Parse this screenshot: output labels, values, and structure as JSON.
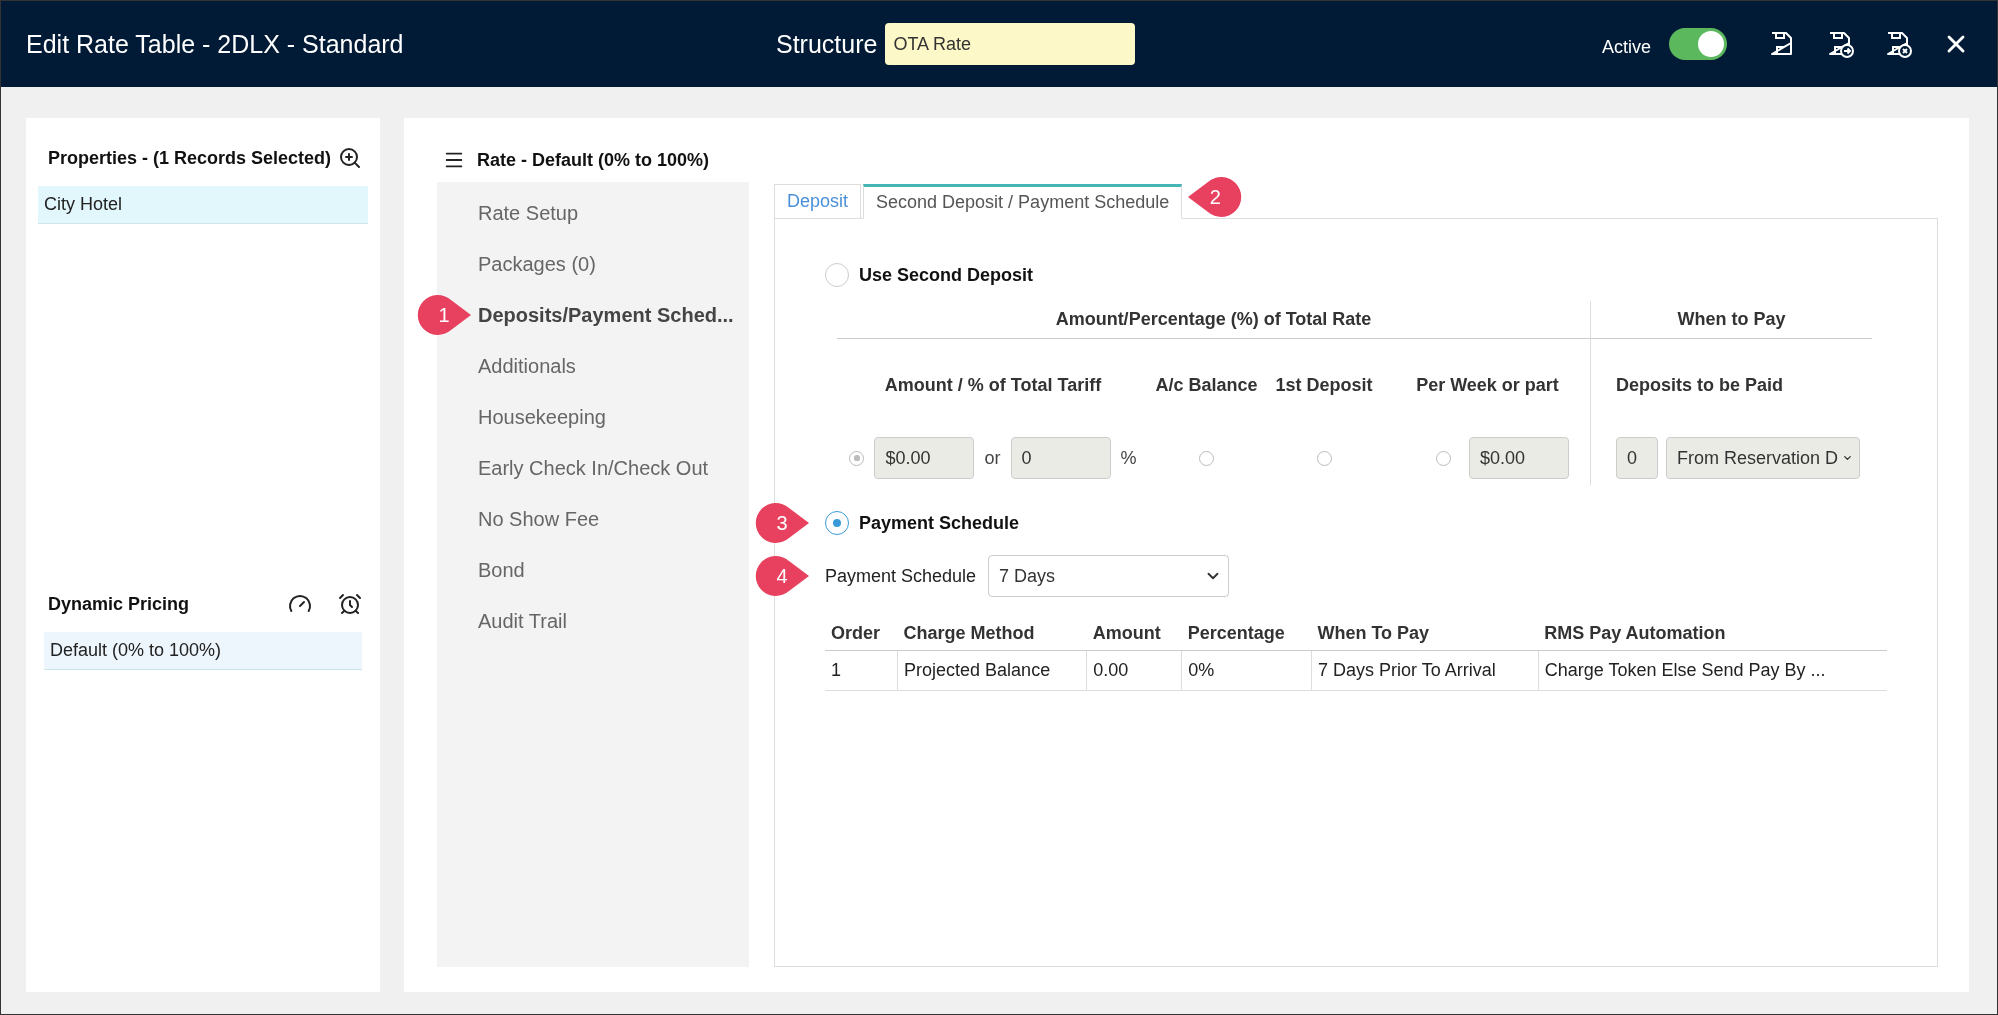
{
  "header": {
    "title": "Edit Rate Table - 2DLX - Standard",
    "structure_label": "Structure",
    "structure_value": "OTA Rate",
    "active_label": "Active",
    "active_on": true
  },
  "properties": {
    "title": "Properties - (1 Records Selected)",
    "items": [
      {
        "label": "City Hotel",
        "selected": true
      }
    ]
  },
  "dynamic_pricing": {
    "title": "Dynamic Pricing",
    "items": [
      {
        "label": "Default (0% to 100%)",
        "selected": true
      }
    ]
  },
  "rate": {
    "title": "Rate - Default (0% to 100%)"
  },
  "nav": [
    {
      "label": "Rate Setup",
      "selected": false
    },
    {
      "label": "Packages (0)",
      "selected": false
    },
    {
      "label": "Deposits/Payment Sched...",
      "selected": true
    },
    {
      "label": "Additionals",
      "selected": false
    },
    {
      "label": "Housekeeping",
      "selected": false
    },
    {
      "label": "Early Check In/Check Out",
      "selected": false
    },
    {
      "label": "No Show Fee",
      "selected": false
    },
    {
      "label": "Bond",
      "selected": false
    },
    {
      "label": "Audit Trail",
      "selected": false
    }
  ],
  "tabs": [
    {
      "label": "Deposit",
      "selected": false
    },
    {
      "label": "Second Deposit / Payment Schedule",
      "selected": true
    }
  ],
  "use_second_deposit": {
    "label": "Use Second Deposit",
    "selected": false
  },
  "deposit_table": {
    "group_heading": "Amount/Percentage (%) of Total Rate",
    "when_heading": "When to Pay",
    "subheadings": [
      "Amount / % of Total Tariff",
      "A/c Balance",
      "1st Deposit",
      "Per Week or part",
      "Deposits to be Paid"
    ],
    "amount_radio_selected": true,
    "amount_value": "$0.00",
    "or_label": "or",
    "percent_value": "0",
    "percent_sign": "%",
    "balance_radio_selected": false,
    "first_deposit_radio_selected": false,
    "per_week_radio_selected": false,
    "per_week_value": "$0.00",
    "deposits_count": "0",
    "deposits_from": "From Reservation D"
  },
  "payment_schedule_option": {
    "label": "Payment Schedule",
    "selected": true
  },
  "payment_schedule_field": {
    "label": "Payment Schedule",
    "value": "7 Days"
  },
  "schedule_table": {
    "columns": [
      "Order",
      "Charge Method",
      "Amount",
      "Percentage",
      "When To Pay",
      "RMS Pay Automation"
    ],
    "rows": [
      [
        "1",
        "Projected Balance",
        "0.00",
        "0%",
        "7 Days Prior To Arrival",
        "Charge Token Else Send Pay By ..."
      ]
    ]
  },
  "callouts": [
    {
      "label": "1"
    },
    {
      "label": "2"
    },
    {
      "label": "3"
    },
    {
      "label": "4"
    }
  ]
}
